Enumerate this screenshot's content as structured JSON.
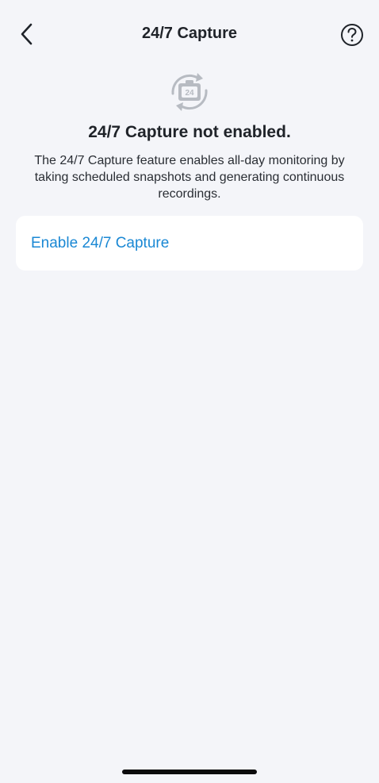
{
  "header": {
    "title": "24/7 Capture",
    "back_icon": "chevron-left-icon",
    "help_icon": "question-circle-icon"
  },
  "status": {
    "icon": "capture-camera-icon",
    "icon_badge": "24",
    "heading": "24/7 Capture not enabled.",
    "description": "The 24/7 Capture feature enables all-day monitoring by taking scheduled snapshots and generating continuous recordings."
  },
  "actions": {
    "enable_label": "Enable 24/7 Capture"
  },
  "colors": {
    "background": "#f4f5f9",
    "accent": "#1a88d4",
    "card": "#ffffff",
    "icon_gray": "#b7bbc2"
  }
}
